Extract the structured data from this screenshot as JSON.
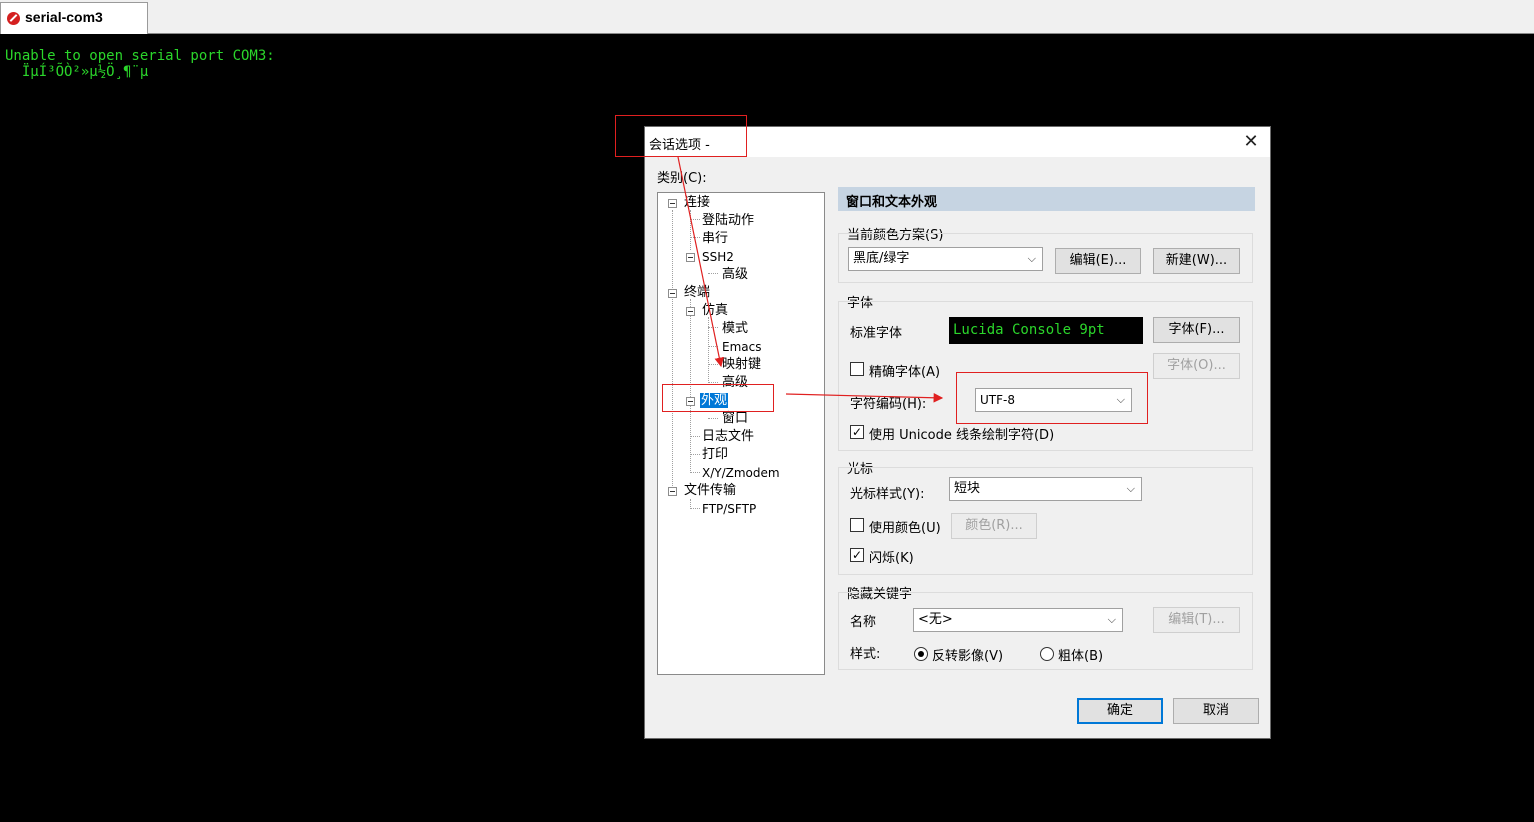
{
  "tab": {
    "title": "serial-com3",
    "icon": "session-icon"
  },
  "terminal": {
    "lines": [
      "Unable to open serial port COM3:",
      "  ÏµÍ³ÕÒ²»µ½Ö¸¶¨µ"
    ],
    "fg_color": "#2bd62b",
    "bg_color": "#000000"
  },
  "dialog": {
    "title": "会话选项 -",
    "close": "✕",
    "category_label": "类别(C):",
    "tree": [
      {
        "label": "连接",
        "expander": "−"
      },
      {
        "label": "登陆动作"
      },
      {
        "label": "串行"
      },
      {
        "label": "SSH2",
        "expander": "−"
      },
      {
        "label": "高级"
      },
      {
        "label": "终端",
        "expander": "−"
      },
      {
        "label": "仿真",
        "expander": "−"
      },
      {
        "label": "模式"
      },
      {
        "label": "Emacs"
      },
      {
        "label": "映射键"
      },
      {
        "label": "高级"
      },
      {
        "label": "外观",
        "expander": "−",
        "selected": true
      },
      {
        "label": "窗口"
      },
      {
        "label": "日志文件"
      },
      {
        "label": "打印"
      },
      {
        "label": "X/Y/Zmodem"
      },
      {
        "label": "文件传输",
        "expander": "−"
      },
      {
        "label": "FTP/SFTP"
      }
    ],
    "section_title": "窗口和文本外观",
    "color_scheme": {
      "label": "当前颜色方案(S)",
      "value": "黑底/绿字",
      "edit_btn": "编辑(E)...",
      "new_btn": "新建(W)..."
    },
    "font": {
      "group_label": "字体",
      "std_font_label": "标准字体",
      "std_font_value": "Lucida Console 9pt",
      "font_btn": "字体(F)...",
      "precise_label": "精确字体(A)",
      "precise_checked": false,
      "font_btn2": "字体(O)...",
      "charset_label": "字符编码(H):",
      "charset_value": "UTF-8",
      "unicode_label": "使用 Unicode 线条绘制字符(D)",
      "unicode_checked": true
    },
    "cursor": {
      "group_label": "光标",
      "style_label": "光标样式(Y):",
      "style_value": "短块",
      "use_color_label": "使用颜色(U)",
      "use_color_checked": false,
      "color_btn": "颜色(R)...",
      "blink_label": "闪烁(K)",
      "blink_checked": true
    },
    "keywords": {
      "group_label": "隐藏关键字",
      "name_label": "名称",
      "name_value": "<无>",
      "edit_btn": "编辑(T)...",
      "style_label": "样式:",
      "reverse_label": "反转影像(V)",
      "reverse_selected": true,
      "bold_label": "粗体(B)",
      "bold_selected": false
    },
    "ok": "确定",
    "cancel": "取消"
  },
  "annotations": {
    "color": "#e02020"
  }
}
